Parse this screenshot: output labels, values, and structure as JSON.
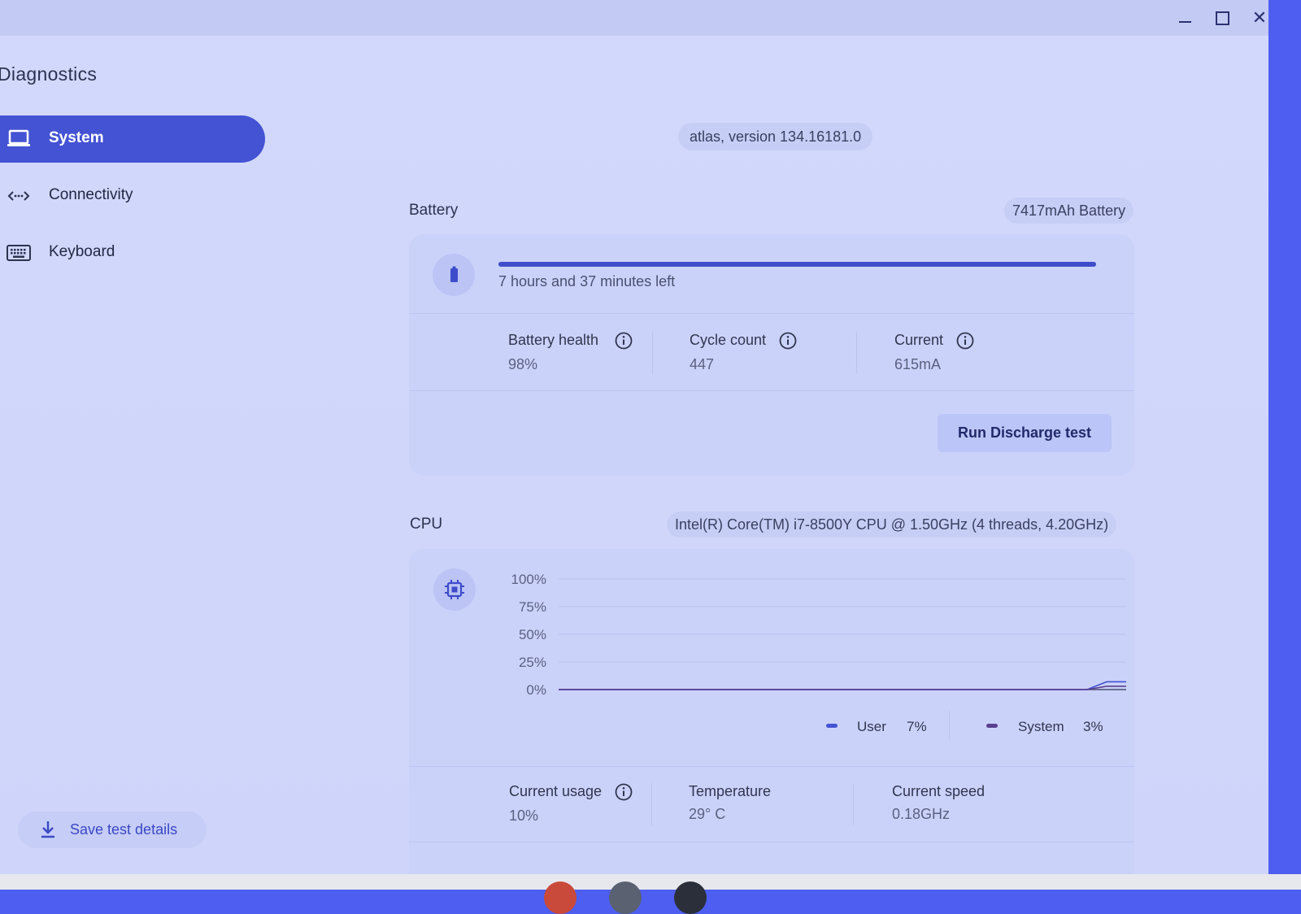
{
  "window": {
    "title": "Diagnostics"
  },
  "sidebar": {
    "items": [
      {
        "label": "System",
        "icon": "laptop-icon",
        "active": true
      },
      {
        "label": "Connectivity",
        "icon": "code-arrows-icon",
        "active": false
      },
      {
        "label": "Keyboard",
        "icon": "keyboard-icon",
        "active": false
      }
    ],
    "save_label": "Save test details"
  },
  "version": "atlas, version 134.16181.0",
  "battery": {
    "title": "Battery",
    "capacity": "7417mAh Battery",
    "charge_fraction": 1.0,
    "time_left": "7 hours and 37 minutes left",
    "stats": [
      {
        "label": "Battery health",
        "value": "98%"
      },
      {
        "label": "Cycle count",
        "value": "447"
      },
      {
        "label": "Current",
        "value": "615mA"
      }
    ],
    "button": "Run Discharge test"
  },
  "cpu": {
    "title": "CPU",
    "model": "Intel(R) Core(TM) i7-8500Y CPU @ 1.50GHz (4 threads, 4.20GHz)",
    "legend": [
      {
        "name": "User",
        "value": "7%",
        "color": "#4453d3"
      },
      {
        "name": "System",
        "value": "3%",
        "color": "#5a3f8f"
      }
    ],
    "stats": [
      {
        "label": "Current usage",
        "value": "10%"
      },
      {
        "label": "Temperature",
        "value": "29° C"
      },
      {
        "label": "Current speed",
        "value": "0.18GHz"
      }
    ]
  },
  "colors": {
    "accent": "#4453d3",
    "background": "#d2d8fb",
    "card": "#cbd2fa"
  },
  "chart_data": {
    "type": "line",
    "yticks": [
      "100%",
      "75%",
      "50%",
      "25%",
      "0%"
    ],
    "ylim": [
      0,
      100
    ],
    "grid": true,
    "series": [
      {
        "name": "User",
        "values": [
          0,
          0,
          0,
          0,
          0,
          0,
          0,
          0,
          0,
          0,
          0,
          0,
          0,
          0,
          0,
          0,
          0,
          0,
          0,
          0,
          0,
          0,
          0,
          0,
          0,
          0,
          0,
          0,
          7,
          7
        ]
      },
      {
        "name": "System",
        "values": [
          0,
          0,
          0,
          0,
          0,
          0,
          0,
          0,
          0,
          0,
          0,
          0,
          0,
          0,
          0,
          0,
          0,
          0,
          0,
          0,
          0,
          0,
          0,
          0,
          0,
          0,
          0,
          0,
          3,
          3
        ]
      }
    ]
  }
}
